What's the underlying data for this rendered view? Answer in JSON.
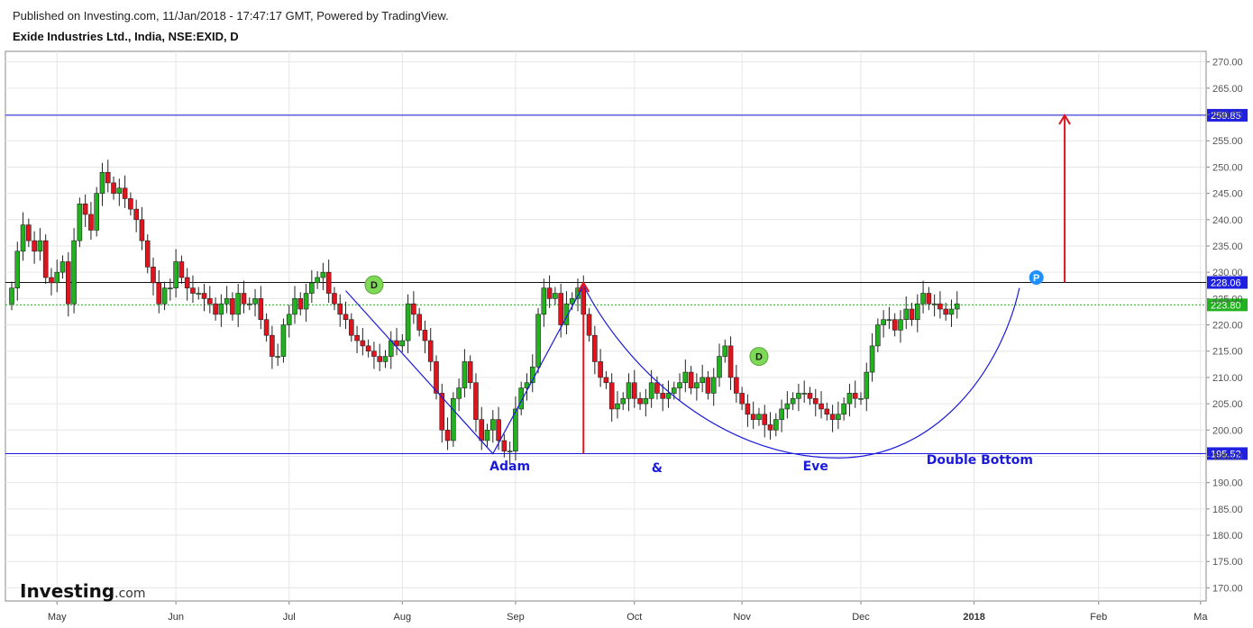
{
  "header": {
    "published": "Published on Investing.com, 11/Jan/2018 - 17:47:17 GMT, Powered by TradingView.",
    "title": "Exide Industries Ltd., India, NSE:EXID, D"
  },
  "brand": {
    "name": "Investing",
    "suffix": ".com"
  },
  "colors": {
    "up": "#22b11f",
    "down": "#e0141e",
    "wick": "#222222",
    "pattern": "#1a1adb",
    "arrow": "#e0141e",
    "grid": "#e6e6e6",
    "price_label": "#2020e0",
    "current_label": "#22b11f"
  },
  "chart_data": {
    "type": "candlestick",
    "ylim": [
      167.5,
      272
    ],
    "y_ticks": [
      "270.00",
      "265.00",
      "260.00",
      "255.00",
      "250.00",
      "245.00",
      "240.00",
      "235.00",
      "230.00",
      "225.00",
      "220.00",
      "215.00",
      "210.00",
      "205.00",
      "200.00",
      "195.00",
      "190.00",
      "185.00",
      "180.00",
      "175.00",
      "170.00"
    ],
    "x_tick_labels": [
      "May",
      "Jun",
      "Jul",
      "Aug",
      "Sep",
      "Oct",
      "Nov",
      "Dec",
      "2018",
      "Feb",
      "Ma"
    ],
    "closes": [
      227,
      234,
      239,
      236,
      234,
      236,
      229,
      228,
      230,
      232,
      224,
      236,
      243,
      241,
      238,
      245,
      249,
      247,
      245,
      246,
      244,
      242,
      240,
      236,
      231,
      228,
      224,
      227,
      227,
      232,
      229,
      227,
      226,
      226,
      225,
      224,
      222,
      224,
      225,
      222,
      226,
      224,
      224,
      225,
      221,
      218,
      214,
      214,
      220,
      222,
      225,
      223,
      226,
      228,
      229,
      230,
      226,
      224,
      222,
      221,
      218,
      217,
      216,
      215,
      214,
      213,
      214,
      217,
      216,
      217,
      224,
      222,
      219,
      217,
      213,
      207,
      200,
      198,
      206,
      208,
      213,
      209,
      202,
      198,
      200,
      202,
      198,
      196,
      196,
      204,
      208,
      209,
      212,
      222,
      227,
      225,
      226,
      220,
      224,
      225,
      227,
      222,
      218,
      213,
      210,
      209,
      204,
      205,
      206,
      209,
      206,
      205,
      206,
      209,
      207,
      206,
      207,
      208,
      209,
      211,
      208,
      209,
      210,
      207,
      210,
      214,
      216,
      210,
      207,
      205,
      203,
      202,
      203,
      201,
      200,
      202,
      204,
      205,
      206,
      207,
      207,
      206,
      205,
      204,
      203,
      202,
      203,
      205,
      207,
      206,
      206,
      211,
      216,
      220,
      221,
      221,
      219,
      221,
      223,
      221,
      224,
      226,
      224,
      224,
      223,
      222,
      223,
      224
    ],
    "level_lines": [
      {
        "value": 259.85,
        "label": "259.85"
      },
      {
        "value": 228.06,
        "label": "228.06"
      },
      {
        "value": 195.52,
        "label": "195.52"
      }
    ],
    "current_price": {
      "value": 223.8,
      "label": "223.80"
    },
    "annotations": [
      {
        "text": "Adam",
        "x": 88,
        "y": 192.3
      },
      {
        "text": "&",
        "x": 114,
        "y": 192.0
      },
      {
        "text": "Eve",
        "x": 142,
        "y": 192.3
      },
      {
        "text": "Double Bottom",
        "x": 171,
        "y": 193.5
      }
    ],
    "markers": [
      {
        "text": "D",
        "x": 64,
        "y": 227.6,
        "color": "#7ed957",
        "textColor": "#1a1a1a"
      },
      {
        "text": "D",
        "x": 132,
        "y": 214.0,
        "color": "#7ed957",
        "textColor": "#1a1a1a"
      },
      {
        "text": "P",
        "x": 181,
        "y": 229.0,
        "color": "#1e90ff",
        "textColor": "#ffffff"
      }
    ],
    "adam_path": [
      [
        59,
        226.5
      ],
      [
        85,
        195.5
      ],
      [
        101,
        227.5
      ]
    ],
    "eve_curve": {
      "start": [
        101,
        227.5
      ],
      "bottom_x": 146,
      "bottom_y": 194.7,
      "end": [
        178,
        227.0
      ]
    },
    "arrows": [
      {
        "x": 101,
        "from": 195.5,
        "to": 228.0
      },
      {
        "x": 186,
        "from": 228.06,
        "to": 259.85
      }
    ]
  }
}
